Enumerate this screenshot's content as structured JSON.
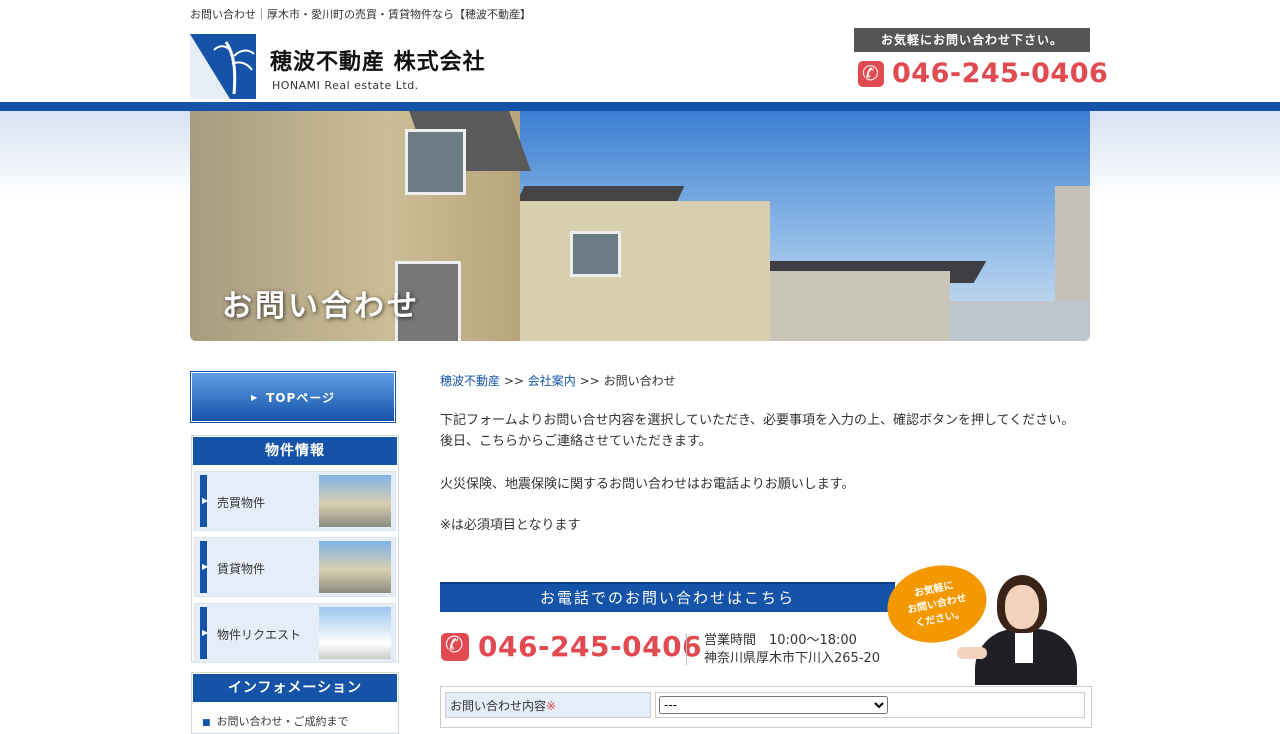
{
  "header": {
    "tagline": "お問い合わせ｜厚木市・愛川町の売買・賃貸物件なら【穂波不動産】",
    "company_name": "穂波不動産 株式会社",
    "company_en": "HONAMI Real estate Ltd.",
    "call_caption": "お気軽にお問い合わせ下さい。",
    "call_number": "046-245-0406"
  },
  "hero": {
    "title": "お問い合わせ"
  },
  "sidebar": {
    "top_button": "TOPページ",
    "property_head": "物件情報",
    "items": [
      {
        "label": "売買物件"
      },
      {
        "label": "賃貸物件"
      },
      {
        "label": "物件リクエスト"
      }
    ],
    "info_head": "インフォメーション",
    "info_item": "お問い合わせ・ご成約まで"
  },
  "breadcrumb": {
    "home": "穂波不動産",
    "sep1": ">>",
    "company": "会社案内",
    "sep2": ">>",
    "current": "お問い合わせ"
  },
  "intro": {
    "line1": "下記フォームよりお問い合せ内容を選択していただき、必要事項を入力の上、確認ボタンを押してください。",
    "line2": "後日、こちらからご連絡させていただきます。",
    "line3": "火災保険、地震保険に関するお問い合わせはお電話よりお願いします。",
    "line4": "※は必須項目となります"
  },
  "phone_section": {
    "banner": "お電話でのお問い合わせはこちら",
    "number": "046-245-0406",
    "hours": "営業時間　10:00～18:00",
    "address": "神奈川県厚木市下川入265-20",
    "bubble_line1": "お気軽に",
    "bubble_line2": "お問い合わせ",
    "bubble_line3": "ください。"
  },
  "form": {
    "label": "お問い合わせ内容",
    "required_mark": "※",
    "select_value": "---"
  },
  "colors": {
    "brand_blue": "#1553a8",
    "accent_red": "#e04a50",
    "bubble_orange": "#f39800"
  }
}
